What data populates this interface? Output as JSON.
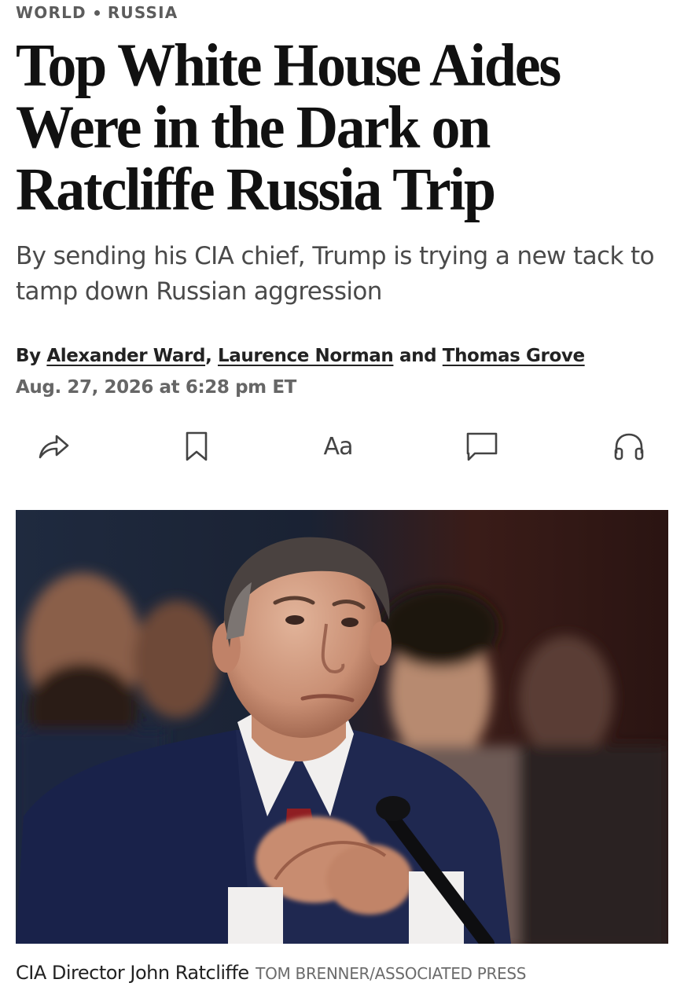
{
  "kicker": {
    "section": "WORLD",
    "subsection": "RUSSIA"
  },
  "article": {
    "headline": "Top White House Aides Were in the Dark on Ratcliffe Russia Trip",
    "dek": "By sending his CIA chief, Trump is trying a new tack to tamp down Russian aggression",
    "byline": {
      "prefix": "By",
      "authors": [
        "Alexander Ward",
        "Laurence Norman",
        "Thomas Grove"
      ],
      "separator": ",",
      "conjunction": "and"
    },
    "timestamp": "Aug. 27, 2026 at 6:28 pm ET"
  },
  "toolbar": {
    "items": [
      {
        "icon": "share-icon"
      },
      {
        "icon": "bookmark-icon"
      },
      {
        "icon": "text-size-icon",
        "label": "Aa"
      },
      {
        "icon": "comment-icon"
      },
      {
        "icon": "headphones-icon"
      }
    ],
    "icon_color": "#444444"
  },
  "photo": {
    "caption": "CIA Director John Ratcliffe",
    "credit": "TOM BRENNER/ASSOCIATED PRESS"
  }
}
